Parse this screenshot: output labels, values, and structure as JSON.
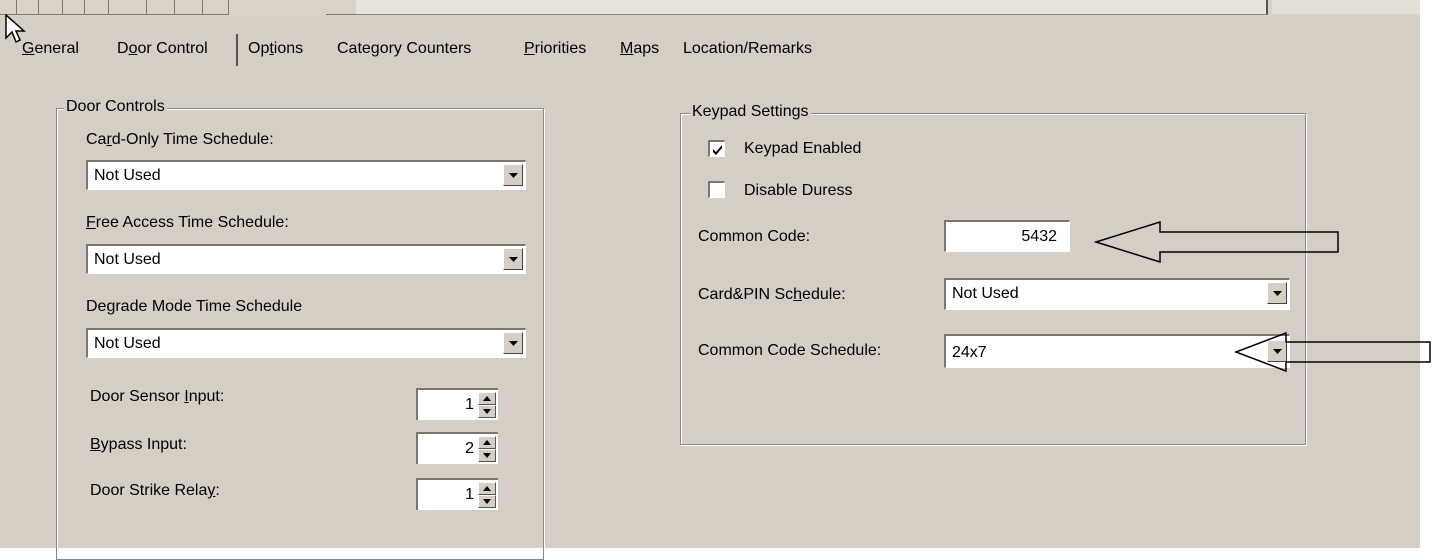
{
  "tabs": [
    {
      "label": "General",
      "mnemonic": "G",
      "rest": "eneral"
    },
    {
      "label": "Door Control",
      "pre": "D",
      "mnemonic": "o",
      "rest": "or Control"
    },
    {
      "label": "Options",
      "pre": "Op",
      "mnemonic": "t",
      "rest": "ions"
    },
    {
      "label": "Category Counters"
    },
    {
      "label": "Priorities",
      "mnemonic": "P",
      "rest": "riorities"
    },
    {
      "label": "Maps",
      "mnemonic": "M",
      "rest": "aps"
    },
    {
      "label": "Location/Remarks"
    }
  ],
  "door_controls": {
    "legend": "Door Controls",
    "card_only_label": {
      "pre": "Ca",
      "mnemonic": "r",
      "rest": "d-Only Time Schedule:"
    },
    "card_only_value": "Not Used",
    "free_access_label": {
      "mnemonic": "F",
      "rest": "ree Access Time Schedule:"
    },
    "free_access_value": "Not Used",
    "degrade_label": "Degrade Mode Time Schedule",
    "degrade_value": "Not Used",
    "sensor_label": {
      "pre": "Door Sensor ",
      "mnemonic": "I",
      "rest": "nput:"
    },
    "sensor_value": "1",
    "bypass_label": {
      "mnemonic": "B",
      "rest": "ypass Input:"
    },
    "bypass_value": "2",
    "strike_label": {
      "pre": "Door Strike Rela",
      "mnemonic": "y",
      "rest": ":"
    },
    "strike_value": "1"
  },
  "keypad": {
    "legend": "Keypad Settings",
    "enabled_label": "Keypad Enabled",
    "enabled_checked": true,
    "duress_label": "Disable Duress",
    "duress_checked": false,
    "common_code_label": "Common Code:",
    "common_code_value": "5432",
    "card_pin_label": {
      "pre": "Card&PIN Sc",
      "mnemonic": "h",
      "rest": "edule:"
    },
    "card_pin_value": "Not Used",
    "common_code_schedule_label": "Common Code Schedule:",
    "common_code_schedule_value": "24x7"
  },
  "icons": [
    "cursor-arrow-icon",
    "dropdown-arrow-icon",
    "spinner-up-icon",
    "spinner-down-icon",
    "checkmark-icon",
    "annotation-arrow-icon"
  ]
}
